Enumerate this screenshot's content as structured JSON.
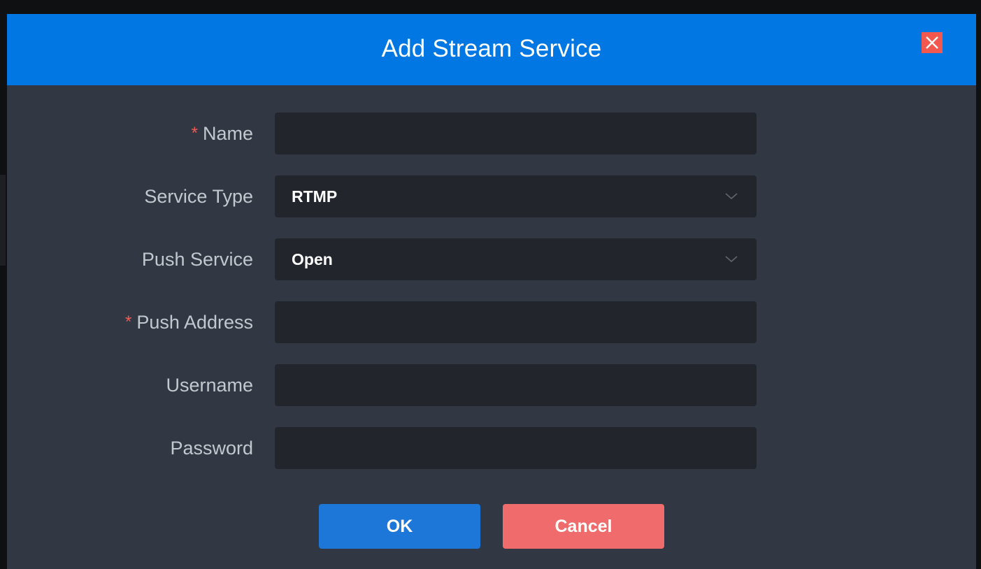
{
  "dialog": {
    "title": "Add Stream Service",
    "close_icon": "close-x-icon"
  },
  "form": {
    "name": {
      "label": "Name",
      "required_mark": "*",
      "value": ""
    },
    "service_type": {
      "label": "Service Type",
      "value": "RTMP",
      "icon": "chevron-down-icon"
    },
    "push_service": {
      "label": "Push Service",
      "value": "Open",
      "icon": "chevron-down-icon"
    },
    "push_address": {
      "label": "Push Address",
      "required_mark": "*",
      "value": ""
    },
    "username": {
      "label": "Username",
      "value": ""
    },
    "password": {
      "label": "Password",
      "value": ""
    }
  },
  "buttons": {
    "ok_label": "OK",
    "cancel_label": "Cancel"
  },
  "colors": {
    "header": "#0077e3",
    "dialog_body": "#313843",
    "field": "#22262c",
    "required": "#f05b55",
    "ok": "#1c77d8",
    "cancel": "#f06b6b",
    "close": "#f2584e"
  }
}
